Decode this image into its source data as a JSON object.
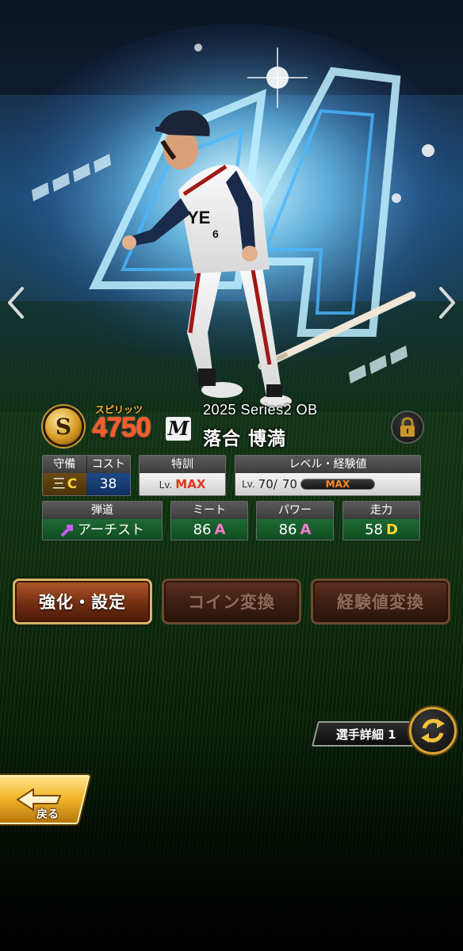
{
  "card": {
    "spirit_label": "スピリッツ",
    "spirit_value": "4750",
    "rank_letter": "S",
    "team_logo": "M",
    "series": "2025 Series2 OB",
    "player_name": "落合 博満"
  },
  "stats": {
    "defense_header": "守備",
    "cost_header": "コスト",
    "position": "三",
    "position_grade": "C",
    "cost": "38",
    "training_header": "特訓",
    "lv_label": "Lv.",
    "training_value": "MAX",
    "level_header": "レベル・経験値",
    "level_current": "70/",
    "level_max": "70",
    "exp_bar_text": "MAX",
    "trajectory_header": "弾道",
    "trajectory_value": "アーチスト",
    "meet_header": "ミート",
    "meet_value": "86",
    "meet_grade": "A",
    "power_header": "パワー",
    "power_value": "86",
    "power_grade": "A",
    "speed_header": "走力",
    "speed_value": "58",
    "speed_grade": "D"
  },
  "actions": {
    "enhance_label": "強化・設定",
    "coin_label": "コイン変換",
    "exp_label": "経験値変換"
  },
  "detail_label": "選手詳細 1",
  "back_label": "戻る",
  "colors": {
    "spirit": "#ff5a2a",
    "grade_a": "#ff7ad0",
    "grade_c_d": "#ffd23a",
    "max": "#e4361c",
    "gold": "#d6a534"
  },
  "icons": [
    "chevron-left-icon",
    "chevron-right-icon",
    "spirit-coin-icon",
    "lock-icon",
    "trajectory-arrow-icon",
    "cycle-arrows-icon",
    "back-arrow-icon"
  ]
}
